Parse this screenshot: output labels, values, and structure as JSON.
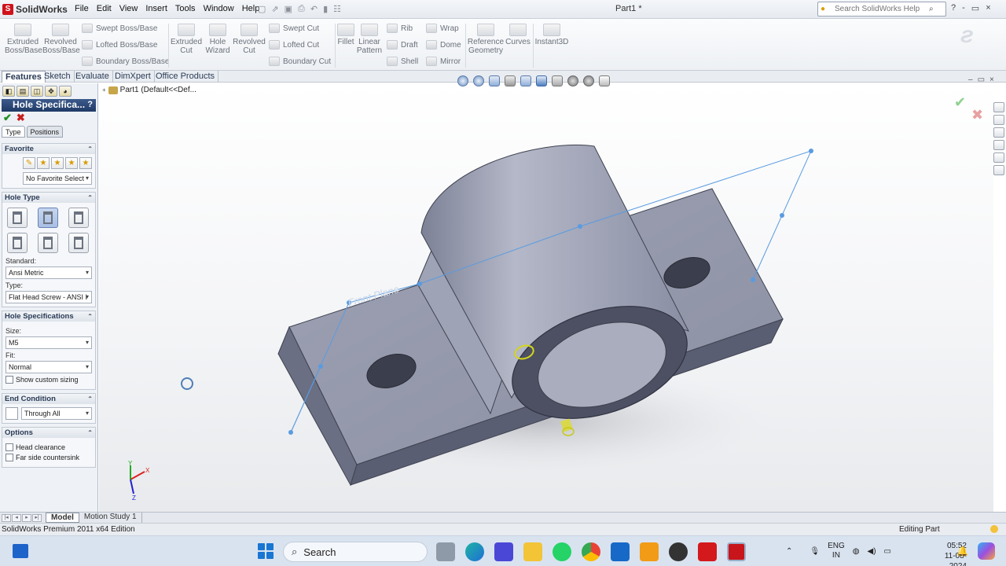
{
  "app": {
    "logo_text": "SolidWorks",
    "document_title": "Part1 *",
    "menu": [
      "File",
      "Edit",
      "View",
      "Insert",
      "Tools",
      "Window",
      "Help"
    ],
    "help_search_placeholder": "Search SolidWorks Help",
    "window_controls": [
      "?",
      "-",
      "▭",
      "×"
    ]
  },
  "ribbon": {
    "big": [
      {
        "label": "Extruded\nBoss/Base"
      },
      {
        "label": "Revolved\nBoss/Base"
      },
      {
        "label": "Extruded\nCut"
      },
      {
        "label": "Hole\nWizard"
      },
      {
        "label": "Revolved\nCut"
      },
      {
        "label": "Fillet"
      },
      {
        "label": "Linear\nPattern"
      },
      {
        "label": "Reference\nGeometry"
      },
      {
        "label": "Curves"
      },
      {
        "label": "Instant3D"
      }
    ],
    "small": [
      "Swept Boss/Base",
      "Lofted Boss/Base",
      "Boundary Boss/Base",
      "Swept Cut",
      "Lofted Cut",
      "Boundary Cut",
      "Rib",
      "Draft",
      "Shell",
      "Wrap",
      "Dome",
      "Mirror"
    ]
  },
  "command_tabs": [
    "Features",
    "Sketch",
    "Evaluate",
    "DimXpert",
    "Office Products"
  ],
  "property_manager": {
    "title": "Hole Specifica...",
    "help": "?",
    "ok": "✔",
    "cancel": "✖",
    "tabs": [
      "Type",
      "Positions"
    ],
    "favorite": {
      "header": "Favorite",
      "select_value": "No Favorite Select"
    },
    "hole_type": {
      "header": "Hole Type",
      "standard_label": "Standard:",
      "standard_value": "Ansi Metric",
      "type_label": "Type:",
      "type_value": "Flat Head Screw - ANSI I"
    },
    "hole_spec": {
      "header": "Hole Specifications",
      "size_label": "Size:",
      "size_value": "M5",
      "fit_label": "Fit:",
      "fit_value": "Normal",
      "custom_sizing": "Show custom sizing"
    },
    "end_condition": {
      "header": "End Condition",
      "value": "Through All"
    },
    "options": {
      "header": "Options",
      "items": [
        "Head clearance",
        "Far side countersink"
      ]
    }
  },
  "viewport": {
    "tree_root": "Part1  (Default<<Def...",
    "sketch_text": "Front Plane",
    "triad_x": "X",
    "triad_y": "Y",
    "triad_z": "Z"
  },
  "bottom_tabs": [
    "Model",
    "Motion Study 1"
  ],
  "status": {
    "left": "SolidWorks Premium 2011 x64 Edition",
    "right": "Editing Part"
  },
  "taskbar": {
    "search_label": "Search",
    "lang_top": "ENG",
    "lang_bottom": "IN",
    "time": "05:52",
    "date": "11-08-2024"
  },
  "colors": {
    "accent": "#1f3a66",
    "part_face_top": "#a7abbc",
    "part_face_side": "#5e6276",
    "sketch_line": "#5a9be0"
  }
}
